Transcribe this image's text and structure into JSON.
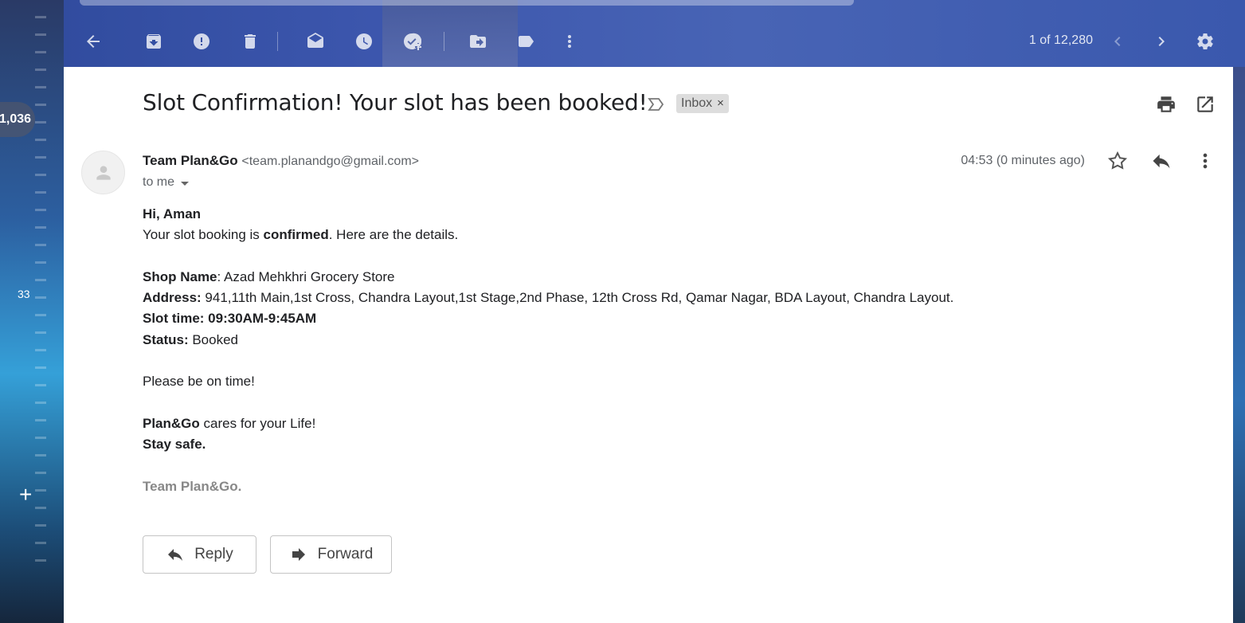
{
  "toolbar": {
    "counter": "1 of 12,280",
    "icons": [
      "back-arrow-icon",
      "archive-icon",
      "report-spam-icon",
      "delete-icon",
      "mark-unread-icon",
      "snooze-icon",
      "add-to-tasks-icon",
      "move-to-icon",
      "labels-icon",
      "more-vert-icon",
      "chevron-left-icon",
      "chevron-right-icon",
      "gear-icon"
    ]
  },
  "rail": {
    "inbox_count": "1,036",
    "secondary_count": "33",
    "plus": "+"
  },
  "email": {
    "subject": "Slot Confirmation! Your slot has been booked!",
    "label_chip": "Inbox",
    "label_chip_close": "×",
    "sender_name": "Team Plan&Go",
    "sender_email": "<team.planandgo@gmail.com>",
    "to": "to me",
    "timestamp": "04:53 (0 minutes ago)",
    "body": {
      "greeting": "Hi, Aman",
      "intro_prefix": "Your slot booking is ",
      "intro_bold": "confirmed",
      "intro_suffix": ". Here are the details.",
      "shop_label": "Shop Name",
      "shop_value": ": Azad Mehkhri Grocery Store",
      "address_label": "Address:",
      "address_value": " 941,11th Main,1st Cross, Chandra Layout,1st Stage,2nd Phase, 12th Cross Rd, Qamar Nagar, BDA Layout, Chandra Layout.",
      "slot_label": "Slot time:",
      "slot_value": " 09:30AM-9:45AM",
      "status_label": "Status:",
      "status_value": " Booked",
      "reminder": "Please be on time!",
      "care_bold": "Plan&Go",
      "care_rest": " cares for your Life!",
      "stay_safe": "Stay safe.",
      "signature": "Team Plan&Go."
    }
  },
  "actions": {
    "reply_label": "Reply",
    "forward_label": "Forward"
  }
}
